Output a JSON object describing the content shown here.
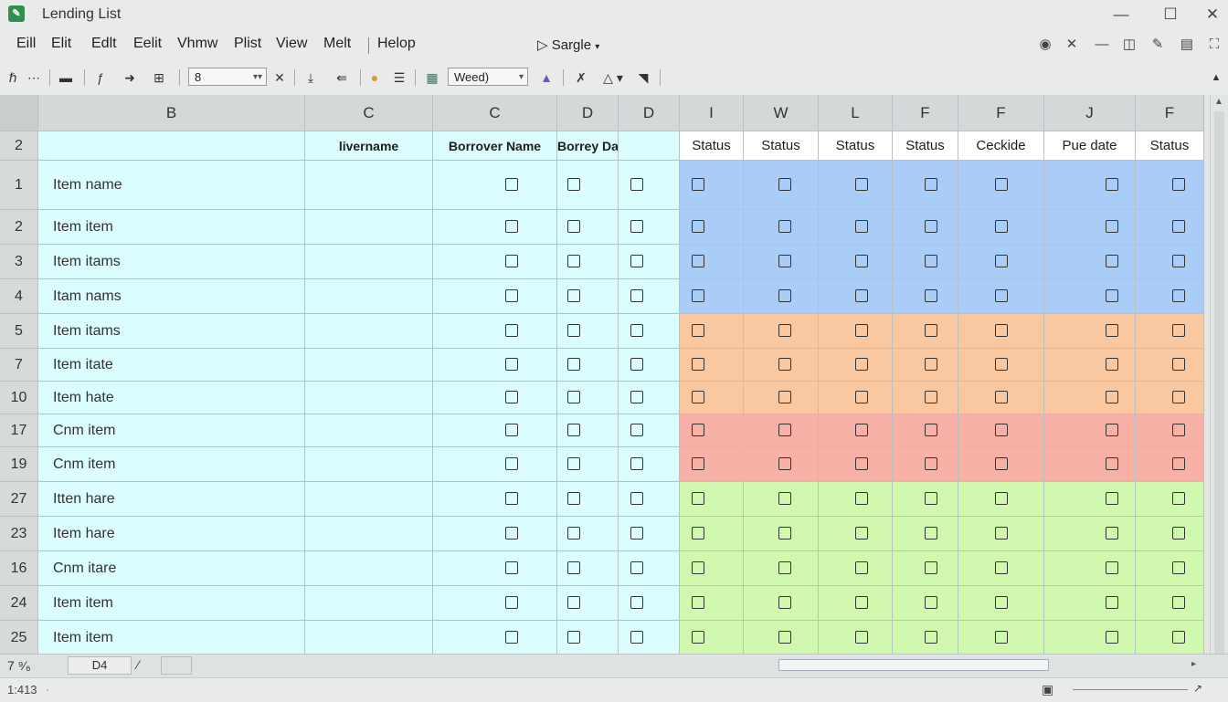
{
  "window": {
    "title": "Lending List",
    "app_icon_glyph": "✎"
  },
  "menu": {
    "items": [
      "Eill",
      "Elit",
      "Edlt",
      "Eelit",
      "Vhmw",
      "Plist",
      "View",
      "Melt",
      "Helop"
    ],
    "sargle": "Sargle"
  },
  "toolbar": {
    "font_size_value": "8",
    "style_value": "Weed)"
  },
  "columns": [
    "B",
    "C",
    "C",
    "D",
    "D",
    "I",
    "W",
    "L",
    "F",
    "F",
    "J",
    "F"
  ],
  "header_row": {
    "row_label": "2",
    "labels": [
      "",
      "livername",
      "Borrover Name",
      "Borrey Date",
      "",
      "Status",
      "Status",
      "Status",
      "Status",
      "Ceckide",
      "Pue date",
      "Status"
    ]
  },
  "rows": [
    {
      "num": "1",
      "item": "Item name",
      "group": "blue"
    },
    {
      "num": "2",
      "item": "Item item",
      "group": "blue"
    },
    {
      "num": "3",
      "item": "Item itams",
      "group": "blue"
    },
    {
      "num": "4",
      "item": "Itam nams",
      "group": "blue"
    },
    {
      "num": "5",
      "item": "Item itams",
      "group": "orange"
    },
    {
      "num": "7",
      "item": "Item itate",
      "group": "orange"
    },
    {
      "num": "10",
      "item": "Item hate",
      "group": "orange"
    },
    {
      "num": "17",
      "item": "Cnm item",
      "group": "red"
    },
    {
      "num": "19",
      "item": "Cnm item",
      "group": "red"
    },
    {
      "num": "27",
      "item": "Itten hare",
      "group": "green"
    },
    {
      "num": "23",
      "item": "Item hare",
      "group": "green"
    },
    {
      "num": "16",
      "item": "Cnm itare",
      "group": "green"
    },
    {
      "num": "24",
      "item": "Item item",
      "group": "green"
    },
    {
      "num": "25",
      "item": "Item item",
      "group": "green"
    }
  ],
  "colors": {
    "cyan": "#dcfdfd",
    "blue": "#a9cdf6",
    "orange": "#fac8a0",
    "red": "#f8b1a6",
    "green": "#d1f8af"
  },
  "tabs": {
    "zoom": "7 ⁹⁄₆",
    "sheet": "D4"
  },
  "status": {
    "cell_ref": "1:413"
  }
}
